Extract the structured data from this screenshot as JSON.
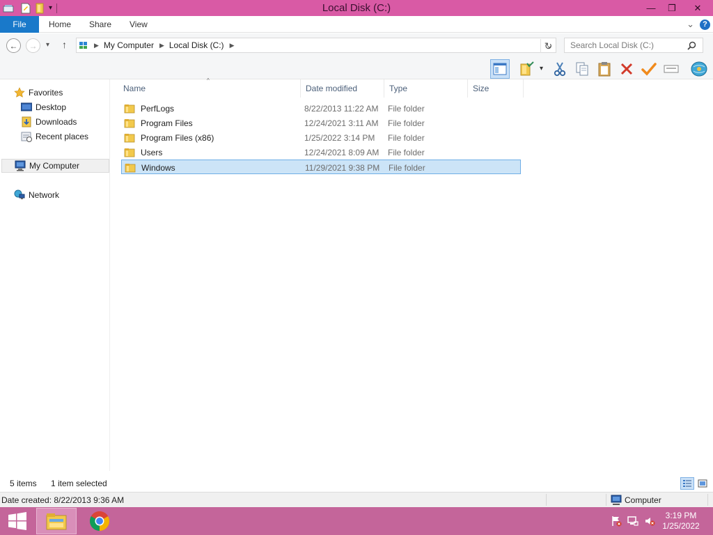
{
  "window": {
    "title": "Local Disk (C:)",
    "minimize_glyph": "—",
    "maximize_glyph": "❐",
    "close_glyph": "✕"
  },
  "ribbon": {
    "file_tab": "File",
    "tabs": [
      "Home",
      "Share",
      "View"
    ],
    "expand_glyph": "⌄",
    "help_glyph": "?"
  },
  "address": {
    "back_glyph": "←",
    "forward_glyph": "→",
    "recent_glyph": "▾",
    "up_glyph": "↑",
    "breadcrumbs": [
      "My Computer",
      "Local Disk (C:)"
    ],
    "separator_glyph": "▶",
    "dropdown_glyph": "⌄",
    "refresh_glyph": "↻",
    "search_placeholder": "Search Local Disk (C:)"
  },
  "toolbar": {
    "icons": [
      "preview-pane-icon",
      "folder-options-icon",
      "cut-icon",
      "copy-icon",
      "paste-icon",
      "delete-icon",
      "select-icon",
      "rename-icon",
      "network-globe-icon"
    ],
    "dropdown_glyph": "▾"
  },
  "nav": {
    "favorites": "Favorites",
    "desktop": "Desktop",
    "downloads": "Downloads",
    "recent_places": "Recent places",
    "my_computer": "My Computer",
    "network": "Network"
  },
  "list": {
    "sort_glyph": "^",
    "columns": [
      "Name",
      "Date modified",
      "Type",
      "Size"
    ],
    "rows": [
      {
        "name": "PerfLogs",
        "date": "8/22/2013 11:22 AM",
        "type": "File folder",
        "size": ""
      },
      {
        "name": "Program Files",
        "date": "12/24/2021 3:11 AM",
        "type": "File folder",
        "size": ""
      },
      {
        "name": "Program Files (x86)",
        "date": "1/25/2022 3:14 PM",
        "type": "File folder",
        "size": ""
      },
      {
        "name": "Users",
        "date": "12/24/2021 8:09 AM",
        "type": "File folder",
        "size": ""
      },
      {
        "name": "Windows",
        "date": "11/29/2021 9:38 PM",
        "type": "File folder",
        "size": ""
      }
    ],
    "selected_index": 4
  },
  "status": {
    "item_count": "5 items",
    "selection": "1 item selected"
  },
  "details": {
    "date_created": "Date created: 8/22/2013 9:36 AM",
    "location": "Computer"
  },
  "taskbar": {
    "apps": [
      "file-explorer-icon",
      "chrome-icon"
    ],
    "time": "3:19 PM",
    "date": "1/25/2022"
  },
  "colors": {
    "titlebar": "#d95aa5",
    "file_tab": "#1979ca",
    "selection": "#cce4f7",
    "taskbar": "#c4659a"
  }
}
